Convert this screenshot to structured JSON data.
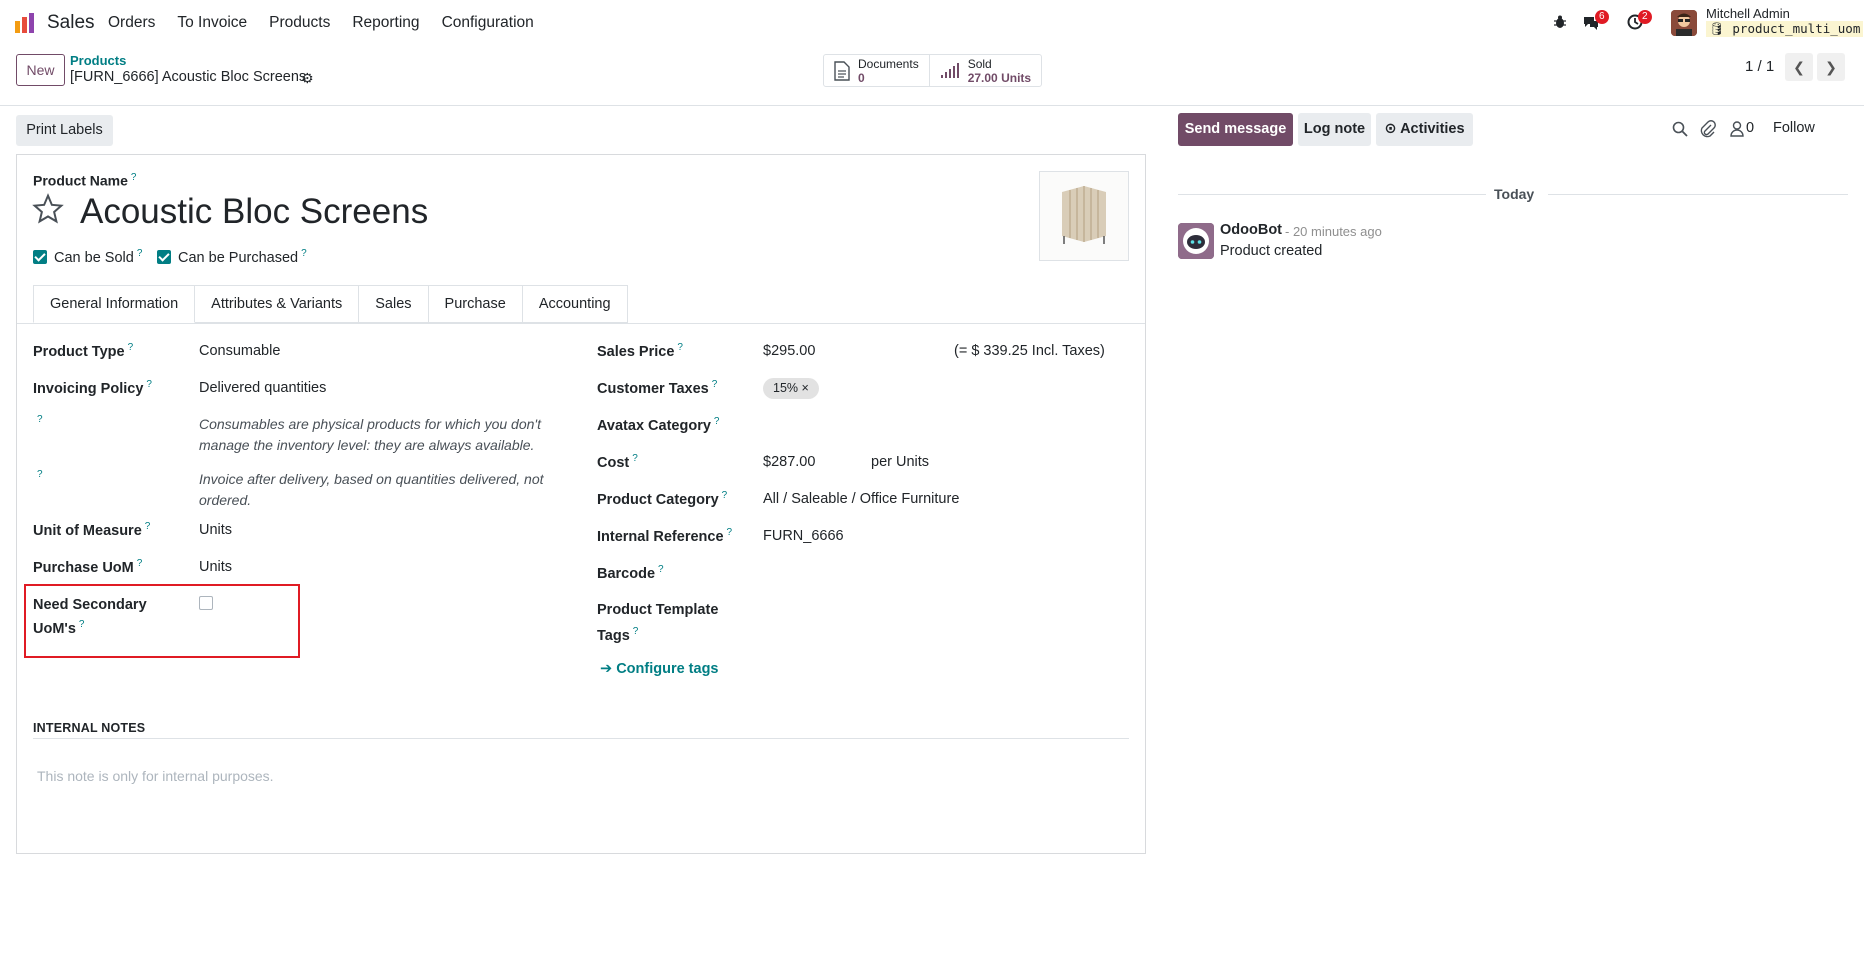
{
  "navbar": {
    "app_name": "Sales",
    "menu": [
      "Orders",
      "To Invoice",
      "Products",
      "Reporting",
      "Configuration"
    ],
    "messages_badge": "6",
    "activities_badge": "2",
    "user_name": "Mitchell Admin",
    "database": "product_multi_uom"
  },
  "control_panel": {
    "new_label": "New",
    "breadcrumb_parent": "Products",
    "breadcrumb_current": "[FURN_6666] Acoustic Bloc Screens",
    "smart_buttons": [
      {
        "label": "Documents",
        "value": "0"
      },
      {
        "label": "Sold",
        "value": "27.00 Units"
      }
    ],
    "pager": "1 / 1"
  },
  "form": {
    "print_labels": "Print Labels",
    "product_name_label": "Product Name",
    "product_name": "Acoustic Bloc Screens",
    "can_be_sold": "Can be Sold",
    "can_be_purchased": "Can be Purchased",
    "tabs": [
      "General Information",
      "Attributes & Variants",
      "Sales",
      "Purchase",
      "Accounting"
    ],
    "left": {
      "product_type_label": "Product Type",
      "product_type": "Consumable",
      "invoicing_policy_label": "Invoicing Policy",
      "invoicing_policy": "Delivered quantities",
      "note1": "Consumables are physical products for which you don't manage the inventory level: they are always available.",
      "note2": "Invoice after delivery, based on quantities delivered, not ordered.",
      "uom_label": "Unit of Measure",
      "uom": "Units",
      "purchase_uom_label": "Purchase UoM",
      "purchase_uom": "Units",
      "secondary_uom_label_1": "Need Secondary",
      "secondary_uom_label_2": "UoM's"
    },
    "right": {
      "sales_price_label": "Sales Price",
      "sales_price": "$295.00",
      "sales_price_incl": "(= $ 339.25 Incl. Taxes)",
      "customer_taxes_label": "Customer Taxes",
      "tax_tag": "15%",
      "avatax_label": "Avatax Category",
      "cost_label": "Cost",
      "cost": "$287.00",
      "cost_unit": "per Units",
      "category_label": "Product Category",
      "category": "All / Saleable / Office Furniture",
      "internal_ref_label": "Internal Reference",
      "internal_ref": "FURN_6666",
      "barcode_label": "Barcode",
      "tags_label_1": "Product Template",
      "tags_label_2": "Tags",
      "configure_tags": "Configure tags"
    },
    "internal_notes_title": "INTERNAL NOTES",
    "internal_notes_placeholder": "This note is only for internal purposes."
  },
  "chatter": {
    "send_message": "Send message",
    "log_note": "Log note",
    "activities": "Activities",
    "followers_count": "0",
    "follow": "Follow",
    "date_separator": "Today",
    "message": {
      "author": "OdooBot",
      "time": "- 20 minutes ago",
      "body": "Product created"
    }
  },
  "colors": {
    "brand": "#714B67",
    "link": "#017e84",
    "highlight": "#e01b24"
  }
}
